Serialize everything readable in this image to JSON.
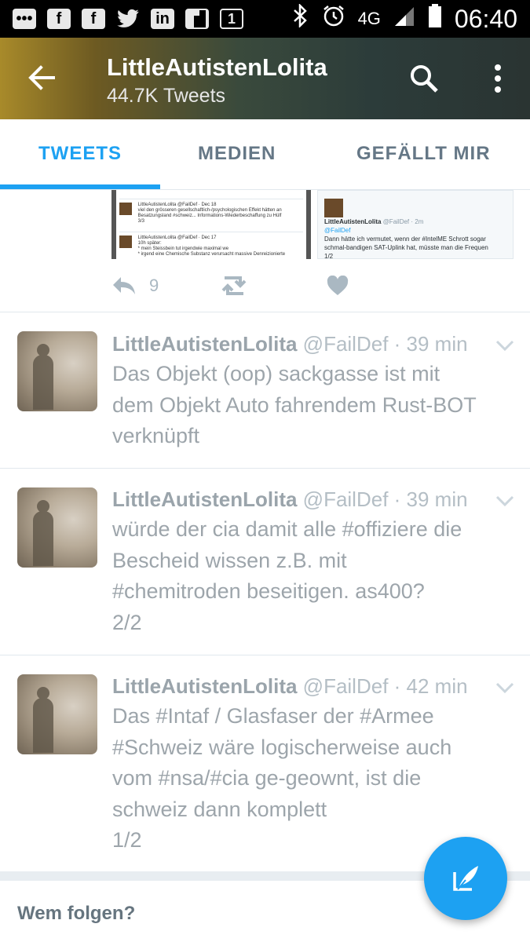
{
  "status_bar": {
    "left_icons": [
      "chat-icon",
      "facebook-icon",
      "facebook-icon",
      "twitter-icon",
      "linkedin-icon",
      "flipboard-icon",
      "notification-one-icon"
    ],
    "network": "4G",
    "time": "06:40"
  },
  "header": {
    "title": "LittleAutistenLolita",
    "subtitle": "44.7K Tweets"
  },
  "tabs": [
    {
      "label": "TWEETS",
      "active": true
    },
    {
      "label": "MEDIEN",
      "active": false
    },
    {
      "label": "GEFÄLLT MIR",
      "active": false
    }
  ],
  "media_preview": {
    "left": {
      "line1": "LittleAutistenLolita @FailDef · Dec 18",
      "line2": "viel den grösseren gesellschaftlich-/psychologischen Effekt hätten an",
      "line3": "Besatzungsland #schweiz... Informations-Wiederbeschaffung zu Hülf",
      "line4": "3/3",
      "line5": "LittleAutistenLolita @FailDef · Dec 17",
      "line6": "10h später:",
      "line7": "* mein Steissbein tut irgendwie maximal we",
      "line8": "* irgend eine Chemische Substanz verursacht massive Denreizionierte"
    },
    "right": {
      "name": "LittleAutistenLolita",
      "handle": "@FailDef · 2m",
      "reply": "@FailDef",
      "text1": "Dann hätte ich vermutet, wenn der #IntelME Schrott sogar",
      "text2": "schmal-bandigen SAT-Uplink hat, müsste man die Frequen",
      "text3": "1/2"
    }
  },
  "first_tweet_actions": {
    "reply_count": "9"
  },
  "tweets": [
    {
      "name": "LittleAutistenLolita",
      "handle": "@FailDef · 39 min",
      "lines": [
        "Das Objekt (oop) sackgasse ist mit",
        "dem Objekt Auto fahrendem Rust-BOT",
        "verknüpft"
      ]
    },
    {
      "name": "LittleAutistenLolita",
      "handle": "@FailDef · 39 min",
      "lines": [
        "würde der cia damit alle #offiziere die",
        "Bescheid wissen z.B. mit",
        "#chemitroden beseitigen. as400?",
        "2/2"
      ]
    },
    {
      "name": "LittleAutistenLolita",
      "handle": "@FailDef · 42 min",
      "lines": [
        "Das #Intaf / Glasfaser der #Armee",
        "#Schweiz wäre logischerweise auch",
        "vom #nsa/#cia ge-geownt, ist die",
        "schweiz dann komplett",
        "1/2"
      ]
    }
  ],
  "footer": {
    "who_to_follow": "Wem folgen?"
  },
  "colors": {
    "accent": "#1da1f2",
    "muted_text": "#9da5ab"
  }
}
